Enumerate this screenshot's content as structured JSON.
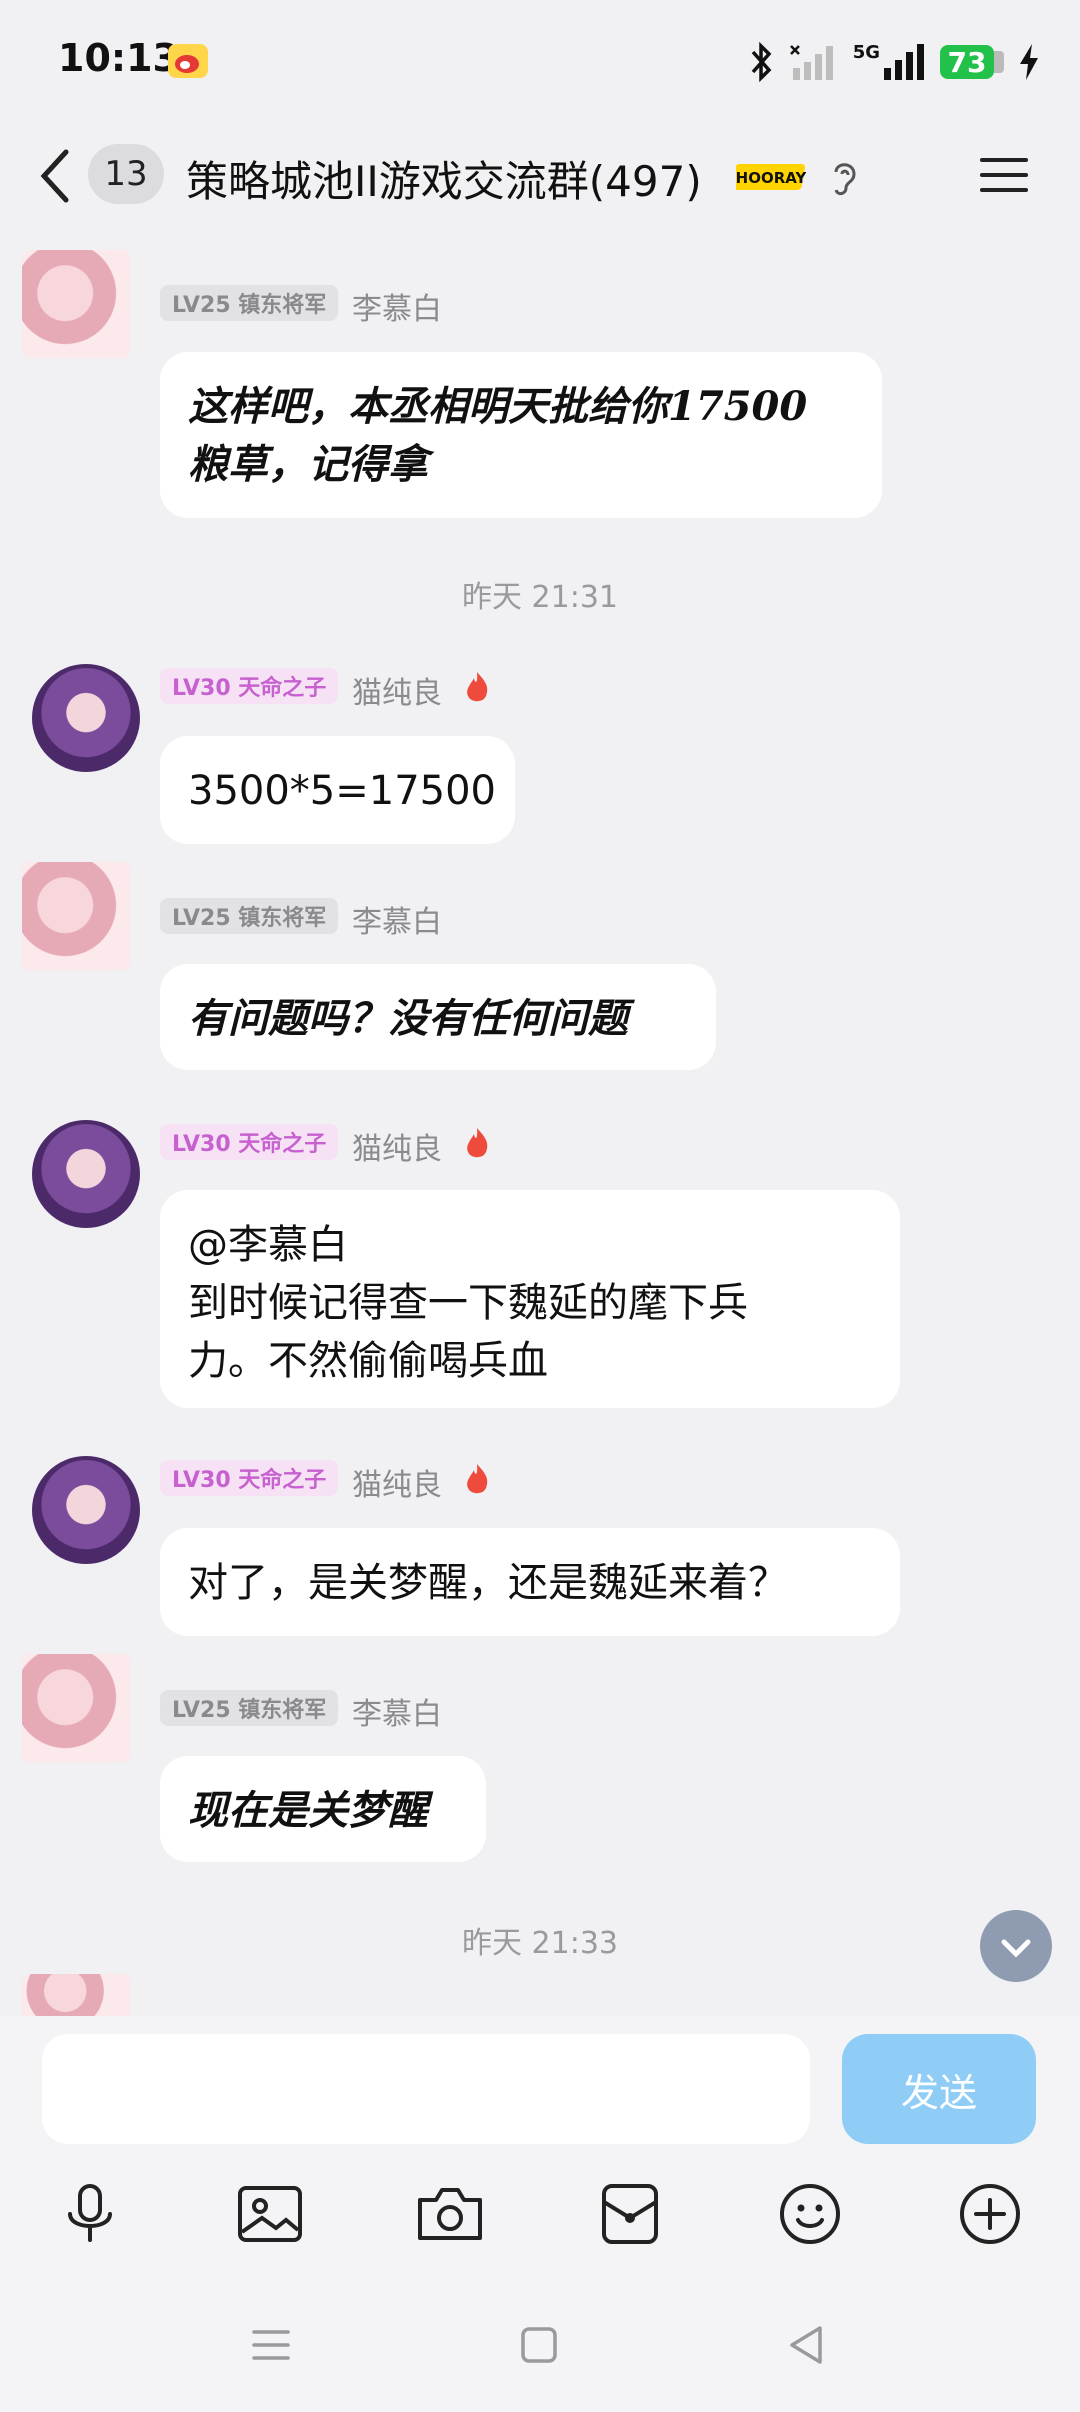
{
  "status_bar": {
    "time": "10:13",
    "network": "5G",
    "battery": "73"
  },
  "header": {
    "unread_count": "13",
    "title": "策略城池II游戏交流群(497)",
    "hooray_text": "HOORAY"
  },
  "messages": [
    {
      "badge": "LV25 镇东将军",
      "nick": "李慕白",
      "text": "这样吧，本丞相明天批给你17500\n粮草，记得拿"
    },
    {
      "divider": "昨天 21:31"
    },
    {
      "badge": "LV30 天命之子",
      "nick": "猫纯良",
      "text": "3500*5=17500"
    },
    {
      "badge": "LV25 镇东将军",
      "nick": "李慕白",
      "text": "有问题吗？没有任何问题"
    },
    {
      "badge": "LV30 天命之子",
      "nick": "猫纯良",
      "text": "@李慕白\n到时候记得查一下魏延的麾下兵\n力。不然偷偷喝兵血"
    },
    {
      "badge": "LV30 天命之子",
      "nick": "猫纯良",
      "text": "对了，是关梦醒，还是魏延来着？"
    },
    {
      "badge": "LV25 镇东将军",
      "nick": "李慕白",
      "text": "现在是关梦醒"
    },
    {
      "divider": "昨天 21:33"
    }
  ],
  "input": {
    "placeholder": "",
    "send_label": "发送"
  },
  "toolbar": [
    "microphone-icon",
    "image-icon",
    "camera-icon",
    "red-packet-icon",
    "emoji-icon",
    "plus-icon"
  ],
  "colors": {
    "accent": "#8fcdf6",
    "badge_purple": "#c661cf",
    "battery": "#22c24a"
  }
}
